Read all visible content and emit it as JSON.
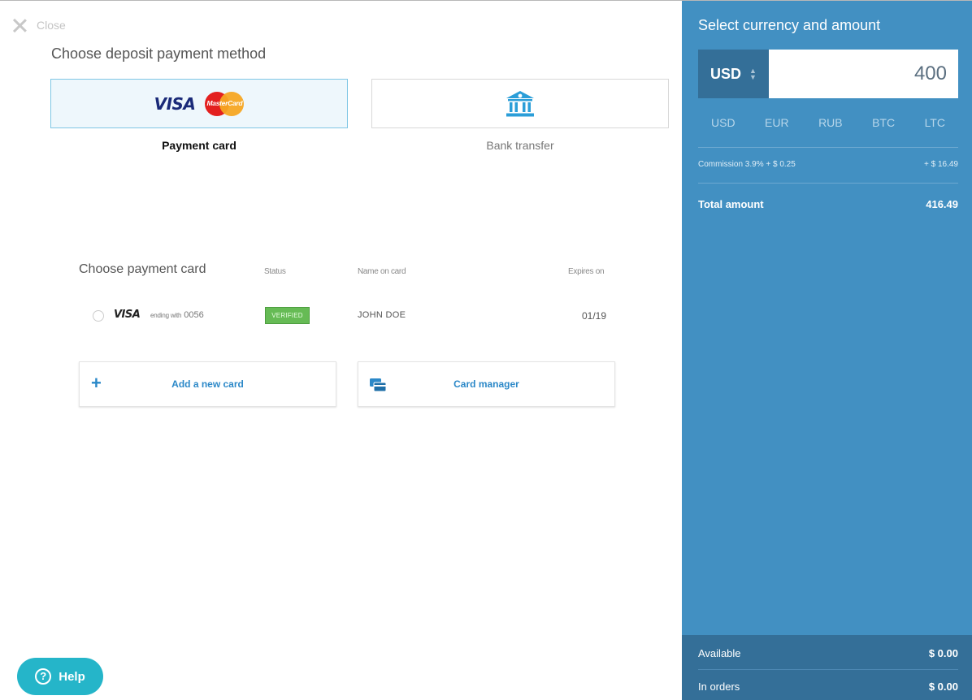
{
  "close": {
    "label": "Close"
  },
  "payment_methods": {
    "title": "Choose deposit payment method",
    "items": [
      {
        "label": "Payment card",
        "icons": [
          "visa-logo",
          "mastercard-logo"
        ],
        "visa_text": "VISA",
        "mastercard_text": "MasterCard",
        "active": true
      },
      {
        "label": "Bank transfer",
        "icons": [
          "bank-icon"
        ],
        "active": false
      }
    ]
  },
  "cards": {
    "title": "Choose payment card",
    "columns": {
      "status": "Status",
      "name": "Name on card",
      "expires": "Expires on"
    },
    "rows": [
      {
        "brand": "VISA",
        "ending_prefix": "ending with",
        "ending_number": "0056",
        "status": "VERIFIED",
        "name": "JOHN DOE",
        "expires": "01/19"
      }
    ],
    "add_label": "Add a new card",
    "manager_label": "Card manager"
  },
  "help": {
    "label": "Help"
  },
  "panel": {
    "title": "Select currency and amount",
    "currency": "USD",
    "amount": "400",
    "currencies": [
      "USD",
      "EUR",
      "RUB",
      "BTC",
      "LTC"
    ],
    "commission_label": "Commission 3.9% + $ 0.25",
    "commission_value": "+ $ 16.49",
    "total_label": "Total amount",
    "total_value": "416.49",
    "available_label": "Available",
    "available_value": "$ 0.00",
    "orders_label": "In orders",
    "orders_value": "$ 0.00"
  },
  "colors": {
    "panel_bg": "#4290c2",
    "panel_dark": "#346f98",
    "accent": "#2b88c8",
    "verified": "#66bb55",
    "help": "#25b5c9"
  }
}
